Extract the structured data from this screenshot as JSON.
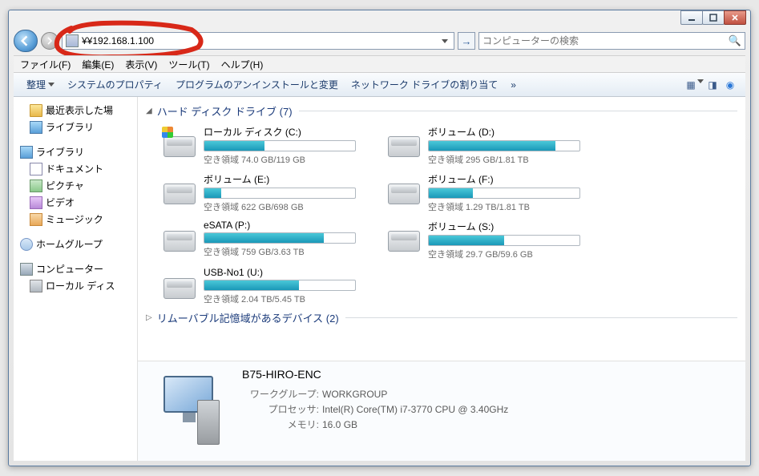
{
  "address": "¥¥192.168.1.100",
  "search_placeholder": "コンピューターの検索",
  "menu": {
    "file": "ファイル(F)",
    "edit": "編集(E)",
    "view": "表示(V)",
    "tools": "ツール(T)",
    "help": "ヘルプ(H)"
  },
  "toolbar": {
    "organize": "整理",
    "sysprops": "システムのプロパティ",
    "uninstall": "プログラムのアンインストールと変更",
    "netdrive": "ネットワーク ドライブの割り当て",
    "more": "»"
  },
  "sidebar": {
    "recent": "最近表示した場",
    "libraries": "ライブラリ",
    "libraries2": "ライブラリ",
    "documents": "ドキュメント",
    "pictures": "ピクチャ",
    "videos": "ビデオ",
    "music": "ミュージック",
    "homegroup": "ホームグループ",
    "computer": "コンピューター",
    "localdisk": "ローカル ディス"
  },
  "sections": {
    "hdd": "ハード ディスク ドライブ (7)",
    "removable": "リムーバブル記憶域があるデバイス (2)"
  },
  "drives": [
    {
      "name": "ローカル ディスク (C:)",
      "free": "空き領域 74.0 GB/119 GB",
      "fill": 40,
      "os": true
    },
    {
      "name": "ボリューム (D:)",
      "free": "空き領域 295 GB/1.81 TB",
      "fill": 84
    },
    {
      "name": "ボリューム (E:)",
      "free": "空き領域 622 GB/698 GB",
      "fill": 11
    },
    {
      "name": "ボリューム (F:)",
      "free": "空き領域 1.29 TB/1.81 TB",
      "fill": 29
    },
    {
      "name": "eSATA (P:)",
      "free": "空き領域 759 GB/3.63 TB",
      "fill": 79
    },
    {
      "name": "ボリューム (S:)",
      "free": "空き領域 29.7 GB/59.6 GB",
      "fill": 50
    },
    {
      "name": "USB-No1 (U:)",
      "free": "空き領域 2.04 TB/5.45 TB",
      "fill": 63
    }
  ],
  "details": {
    "name": "B75-HIRO-ENC",
    "workgroup_lbl": "ワークグループ:",
    "workgroup": "WORKGROUP",
    "cpu_lbl": "プロセッサ:",
    "cpu": "Intel(R) Core(TM) i7-3770 CPU @ 3.40GHz",
    "mem_lbl": "メモリ:",
    "mem": "16.0 GB"
  }
}
